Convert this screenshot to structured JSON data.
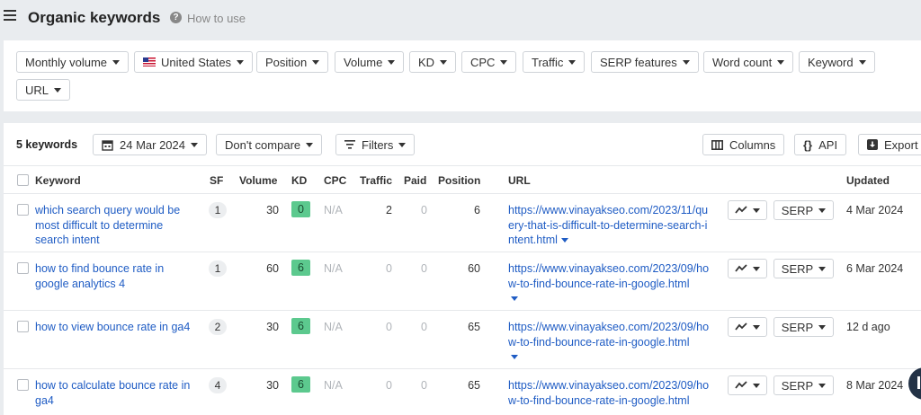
{
  "header": {
    "title": "Organic keywords",
    "help_label": "How to use"
  },
  "filters": [
    {
      "label": "Monthly volume"
    },
    {
      "label": "United States",
      "flag": "us-flag"
    },
    {
      "label": "Position"
    },
    {
      "label": "Volume"
    },
    {
      "label": "KD"
    },
    {
      "label": "CPC"
    },
    {
      "label": "Traffic"
    },
    {
      "label": "SERP features"
    },
    {
      "label": "Word count"
    },
    {
      "label": "Keyword"
    },
    {
      "label": "URL"
    }
  ],
  "toolbar": {
    "count": "5 keywords",
    "date": "24 Mar 2024",
    "compare": "Don't compare",
    "filters": "Filters",
    "columns": "Columns",
    "api": "API",
    "export": "Export"
  },
  "columns": {
    "keyword": "Keyword",
    "sf": "SF",
    "volume": "Volume",
    "kd": "KD",
    "cpc": "CPC",
    "traffic": "Traffic",
    "paid": "Paid",
    "position": "Position",
    "url": "URL",
    "updated": "Updated"
  },
  "rows": [
    {
      "keyword": "which search query would be most difficult to determine search intent",
      "sf": "1",
      "volume": "30",
      "kd": "0",
      "cpc": "N/A",
      "traffic": "2",
      "paid": "0",
      "position": "6",
      "url": "https://www.vinayakseo.com/2023/11/query-that-is-difficult-to-determine-search-intent.html",
      "serp": "SERP",
      "updated": "4 Mar 2024"
    },
    {
      "keyword": "how to find bounce rate in google analytics 4",
      "sf": "1",
      "volume": "60",
      "kd": "6",
      "cpc": "N/A",
      "traffic": "0",
      "paid": "0",
      "position": "60",
      "url": "https://www.vinayakseo.com/2023/09/how-to-find-bounce-rate-in-google.html",
      "serp": "SERP",
      "updated": "6 Mar 2024"
    },
    {
      "keyword": "how to view bounce rate in ga4",
      "sf": "2",
      "volume": "30",
      "kd": "6",
      "cpc": "N/A",
      "traffic": "0",
      "paid": "0",
      "position": "65",
      "url": "https://www.vinayakseo.com/2023/09/how-to-find-bounce-rate-in-google.html",
      "serp": "SERP",
      "updated": "12 d ago"
    },
    {
      "keyword": "how to calculate bounce rate in ga4",
      "sf": "4",
      "volume": "30",
      "kd": "6",
      "cpc": "N/A",
      "traffic": "0",
      "paid": "0",
      "position": "65",
      "url": "https://www.vinayakseo.com/2023/09/how-to-find-bounce-rate-in-google.html",
      "serp": "SERP",
      "updated": "8 Mar 2024"
    }
  ],
  "colors": {
    "link": "#1f5cc4",
    "kd_badge": "#5cc98e",
    "background": "#e9ecef"
  }
}
